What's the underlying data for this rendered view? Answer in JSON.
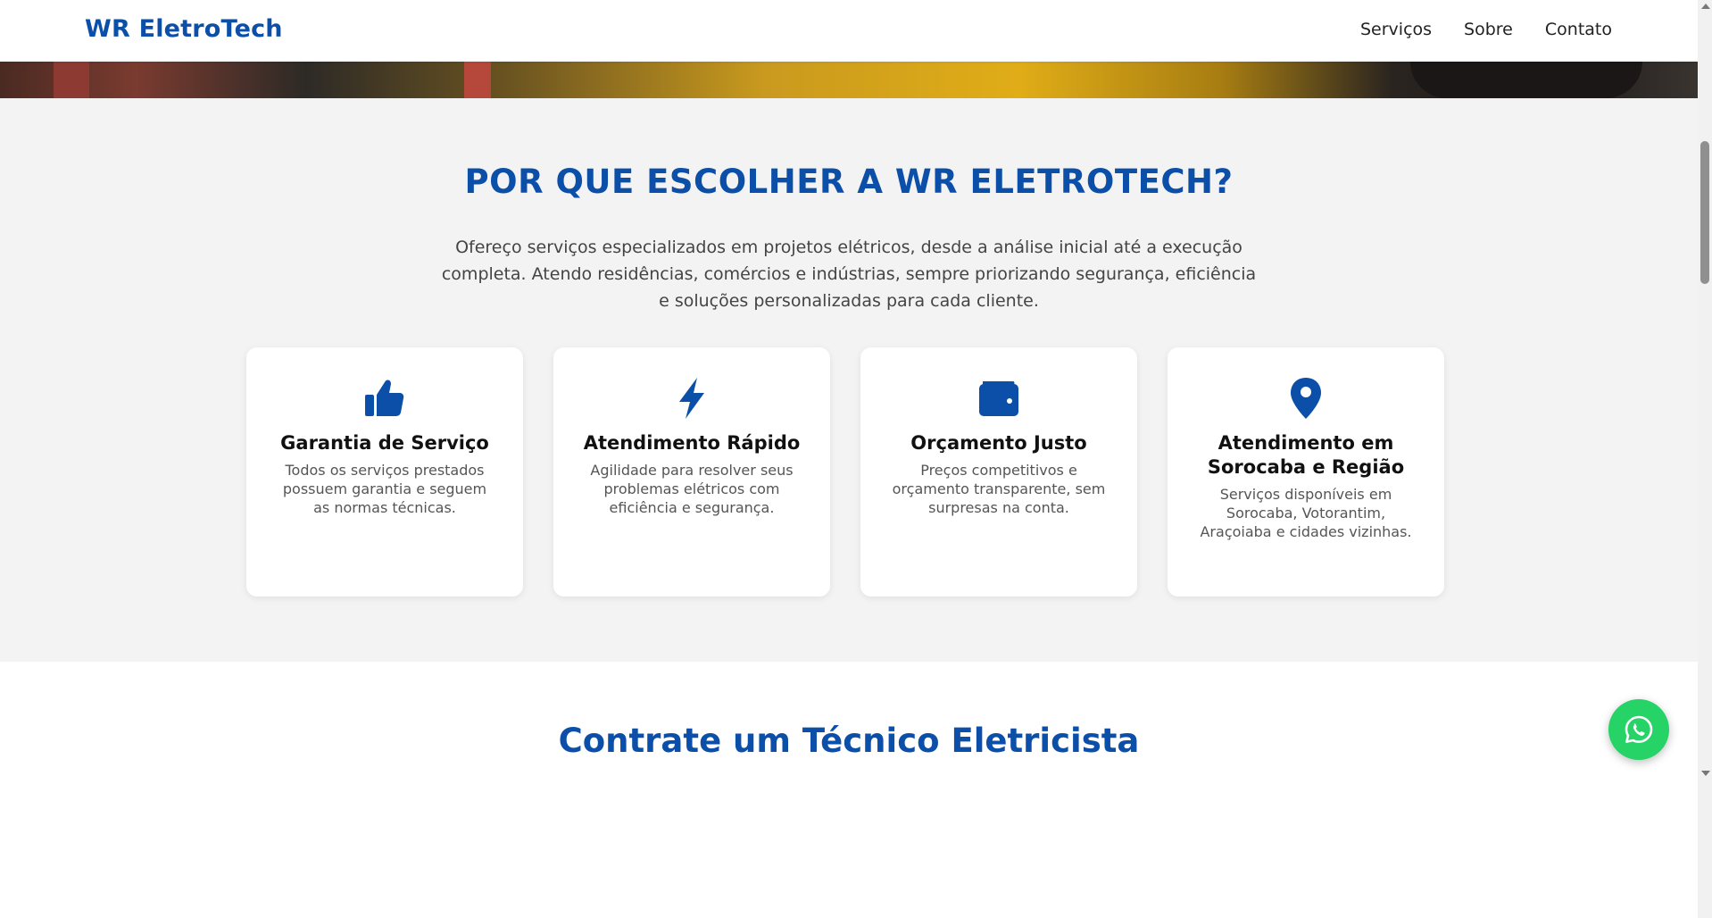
{
  "header": {
    "brand": "WR EletroTech",
    "nav": [
      "Serviços",
      "Sobre",
      "Contato"
    ]
  },
  "why": {
    "title": "POR QUE ESCOLHER A WR ELETROTECH?",
    "description": "Ofereço serviços especializados em projetos elétricos, desde a análise inicial até a execução completa. Atendo residências, comércios e indústrias, sempre priorizando segurança, eficiência e soluções personalizadas para cada cliente.",
    "cards": [
      {
        "icon": "thumbs-up-icon",
        "title": "Garantia de Serviço",
        "text": "Todos os serviços prestados possuem garantia e seguem as normas técnicas."
      },
      {
        "icon": "bolt-icon",
        "title": "Atendimento Rápido",
        "text": "Agilidade para resolver seus problemas elétricos com eficiência e segurança."
      },
      {
        "icon": "wallet-icon",
        "title": "Orçamento Justo",
        "text": "Preços competitivos e orçamento transparente, sem surpresas na conta."
      },
      {
        "icon": "location-pin-icon",
        "title": "Atendimento em Sorocaba e Região",
        "text": "Serviços disponíveis em Sorocaba, Votorantim, Araçoiaba e cidades vizinhas."
      }
    ]
  },
  "hire": {
    "title": "Contrate um Técnico Eletricista"
  },
  "colors": {
    "brand_blue": "#0b4fa8",
    "section_bg": "#f3f3f3",
    "whatsapp_green": "#25d366"
  }
}
